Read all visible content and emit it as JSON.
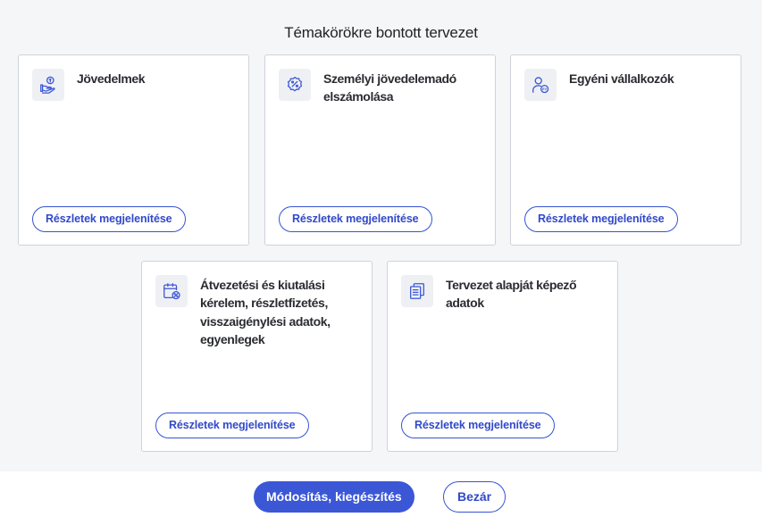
{
  "page": {
    "title": "Témakörökre bontott tervezet"
  },
  "colors": {
    "accent": "#3b57d6",
    "icon": "#3b57d6",
    "card_border": "#cfd3da",
    "background": "#f5f6f8"
  },
  "cards": [
    {
      "title": "Jövedelmek",
      "icon": "hand-coin-icon",
      "button_label": "Részletek megjelenítése"
    },
    {
      "title": "Személyi jövedelemadó elszámolása",
      "icon": "percent-badge-icon",
      "button_label": "Részletek megjelenítése"
    },
    {
      "title": "Egyéni vállalkozók",
      "icon": "entrepreneur-icon",
      "button_label": "Részletek megjelenítése"
    },
    {
      "title": "Átvezetési és kiutalási kérelem, részletfizetés, visszaigénylési adatok, egyenlegek",
      "icon": "calendar-percent-icon",
      "button_label": "Részletek megjelenítése"
    },
    {
      "title": "Tervezet alapját képező adatok",
      "icon": "documents-icon",
      "button_label": "Részletek megjelenítése"
    }
  ],
  "footer": {
    "modify_label": "Módosítás, kiegészítés",
    "close_label": "Bezár"
  }
}
